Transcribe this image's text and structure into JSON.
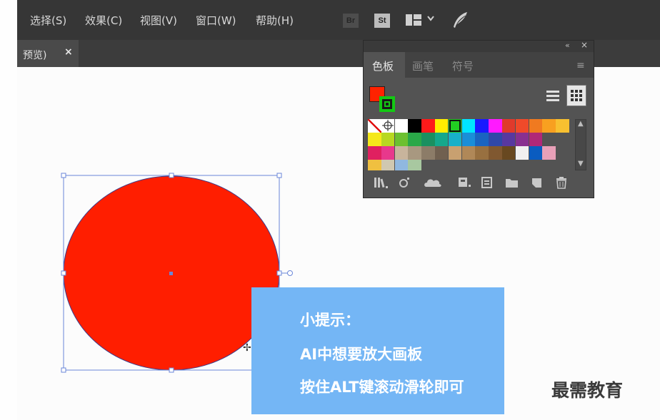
{
  "menubar": {
    "items": [
      "选择(S)",
      "效果(C)",
      "视图(V)",
      "窗口(W)",
      "帮助(H)"
    ],
    "bridge_badge": "Br",
    "stock_badge": "St"
  },
  "document_tab": {
    "label": "预览)",
    "close": "×"
  },
  "swatch_panel": {
    "collapse": "«",
    "close": "×",
    "tabs": [
      "色板",
      "画笔",
      "符号"
    ],
    "menu_icon": "≡",
    "fill_color": "#ff2200",
    "stroke_color": "#13c913",
    "list_view_icon": "list-view-icon",
    "grid_view_icon": "grid-view-icon",
    "swatch_rows": [
      [
        "none",
        "registration",
        "#ffffff",
        "#000000",
        "#ff1a1a",
        "#ffee00",
        "#22cc22",
        "#00e5ff",
        "#1a1aff",
        "#ff1aff",
        "#e03a2c",
        "#f04a2a",
        "#f07a20",
        "#f8a020",
        "#f8c030"
      ],
      [
        "#f5e81a",
        "#b8d820",
        "#6cc030",
        "#2aa848",
        "#1a9060",
        "#15a88c",
        "#18b0c8",
        "#1a8ed8",
        "#1a64c0",
        "#3048a8",
        "#5838a0",
        "#883090",
        "#b02878"
      ],
      [
        "#e02060",
        "#e8388c",
        "#c8b49c",
        "#a89880",
        "#8c7c68",
        "#706050",
        "#c8a070",
        "#b08858",
        "#987040",
        "#805830",
        "#684820",
        "#f0f0f0",
        "#0a5cc0",
        "#e8a0b8"
      ],
      [
        "#f0c040",
        "#d0c8b0",
        "#90b8e0",
        "#a8c8a0"
      ]
    ],
    "bottom_icons": [
      "swatch-library-icon",
      "swatch-type-icon",
      "cloud-library-icon",
      "edit-group-icon",
      "swatch-options-icon",
      "new-group-icon",
      "new-swatch-icon",
      "delete-swatch-icon"
    ]
  },
  "tip": {
    "title": "小提示：",
    "line1": "AI中想要放大画板",
    "line2": "按住ALT键滚动滑轮即可"
  },
  "watermark": "最需教育",
  "shape": {
    "fill": "#ff1e00"
  }
}
